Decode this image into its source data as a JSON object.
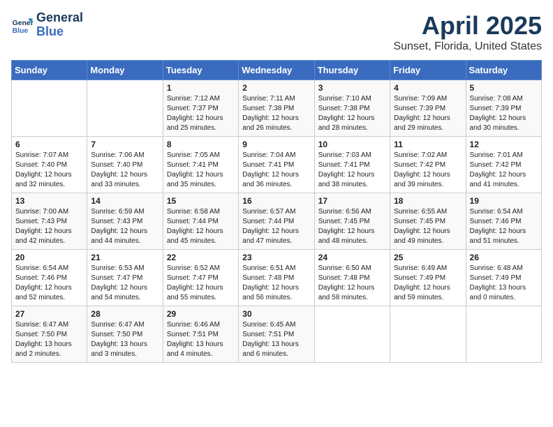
{
  "logo": {
    "line1": "General",
    "line2": "Blue"
  },
  "title": "April 2025",
  "subtitle": "Sunset, Florida, United States",
  "weekdays": [
    "Sunday",
    "Monday",
    "Tuesday",
    "Wednesday",
    "Thursday",
    "Friday",
    "Saturday"
  ],
  "weeks": [
    [
      null,
      null,
      {
        "day": 1,
        "sunrise": "7:12 AM",
        "sunset": "7:37 PM",
        "daylight": "12 hours and 25 minutes."
      },
      {
        "day": 2,
        "sunrise": "7:11 AM",
        "sunset": "7:38 PM",
        "daylight": "12 hours and 26 minutes."
      },
      {
        "day": 3,
        "sunrise": "7:10 AM",
        "sunset": "7:38 PM",
        "daylight": "12 hours and 28 minutes."
      },
      {
        "day": 4,
        "sunrise": "7:09 AM",
        "sunset": "7:39 PM",
        "daylight": "12 hours and 29 minutes."
      },
      {
        "day": 5,
        "sunrise": "7:08 AM",
        "sunset": "7:39 PM",
        "daylight": "12 hours and 30 minutes."
      }
    ],
    [
      {
        "day": 6,
        "sunrise": "7:07 AM",
        "sunset": "7:40 PM",
        "daylight": "12 hours and 32 minutes."
      },
      {
        "day": 7,
        "sunrise": "7:06 AM",
        "sunset": "7:40 PM",
        "daylight": "12 hours and 33 minutes."
      },
      {
        "day": 8,
        "sunrise": "7:05 AM",
        "sunset": "7:41 PM",
        "daylight": "12 hours and 35 minutes."
      },
      {
        "day": 9,
        "sunrise": "7:04 AM",
        "sunset": "7:41 PM",
        "daylight": "12 hours and 36 minutes."
      },
      {
        "day": 10,
        "sunrise": "7:03 AM",
        "sunset": "7:41 PM",
        "daylight": "12 hours and 38 minutes."
      },
      {
        "day": 11,
        "sunrise": "7:02 AM",
        "sunset": "7:42 PM",
        "daylight": "12 hours and 39 minutes."
      },
      {
        "day": 12,
        "sunrise": "7:01 AM",
        "sunset": "7:42 PM",
        "daylight": "12 hours and 41 minutes."
      }
    ],
    [
      {
        "day": 13,
        "sunrise": "7:00 AM",
        "sunset": "7:43 PM",
        "daylight": "12 hours and 42 minutes."
      },
      {
        "day": 14,
        "sunrise": "6:59 AM",
        "sunset": "7:43 PM",
        "daylight": "12 hours and 44 minutes."
      },
      {
        "day": 15,
        "sunrise": "6:58 AM",
        "sunset": "7:44 PM",
        "daylight": "12 hours and 45 minutes."
      },
      {
        "day": 16,
        "sunrise": "6:57 AM",
        "sunset": "7:44 PM",
        "daylight": "12 hours and 47 minutes."
      },
      {
        "day": 17,
        "sunrise": "6:56 AM",
        "sunset": "7:45 PM",
        "daylight": "12 hours and 48 minutes."
      },
      {
        "day": 18,
        "sunrise": "6:55 AM",
        "sunset": "7:45 PM",
        "daylight": "12 hours and 49 minutes."
      },
      {
        "day": 19,
        "sunrise": "6:54 AM",
        "sunset": "7:46 PM",
        "daylight": "12 hours and 51 minutes."
      }
    ],
    [
      {
        "day": 20,
        "sunrise": "6:54 AM",
        "sunset": "7:46 PM",
        "daylight": "12 hours and 52 minutes."
      },
      {
        "day": 21,
        "sunrise": "6:53 AM",
        "sunset": "7:47 PM",
        "daylight": "12 hours and 54 minutes."
      },
      {
        "day": 22,
        "sunrise": "6:52 AM",
        "sunset": "7:47 PM",
        "daylight": "12 hours and 55 minutes."
      },
      {
        "day": 23,
        "sunrise": "6:51 AM",
        "sunset": "7:48 PM",
        "daylight": "12 hours and 56 minutes."
      },
      {
        "day": 24,
        "sunrise": "6:50 AM",
        "sunset": "7:48 PM",
        "daylight": "12 hours and 58 minutes."
      },
      {
        "day": 25,
        "sunrise": "6:49 AM",
        "sunset": "7:49 PM",
        "daylight": "12 hours and 59 minutes."
      },
      {
        "day": 26,
        "sunrise": "6:48 AM",
        "sunset": "7:49 PM",
        "daylight": "13 hours and 0 minutes."
      }
    ],
    [
      {
        "day": 27,
        "sunrise": "6:47 AM",
        "sunset": "7:50 PM",
        "daylight": "13 hours and 2 minutes."
      },
      {
        "day": 28,
        "sunrise": "6:47 AM",
        "sunset": "7:50 PM",
        "daylight": "13 hours and 3 minutes."
      },
      {
        "day": 29,
        "sunrise": "6:46 AM",
        "sunset": "7:51 PM",
        "daylight": "13 hours and 4 minutes."
      },
      {
        "day": 30,
        "sunrise": "6:45 AM",
        "sunset": "7:51 PM",
        "daylight": "13 hours and 6 minutes."
      },
      null,
      null,
      null
    ]
  ]
}
